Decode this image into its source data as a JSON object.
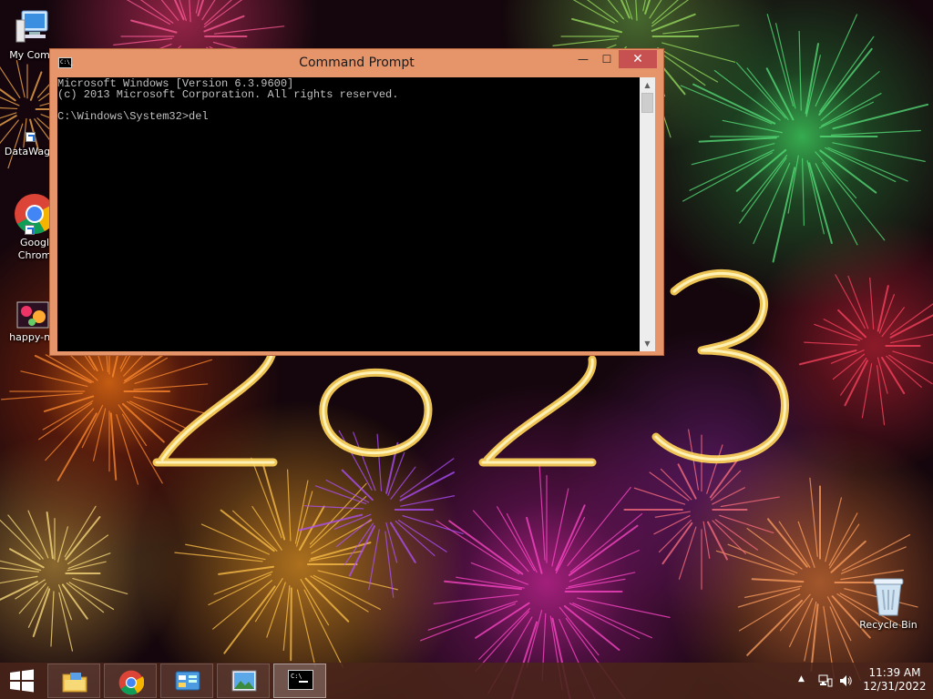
{
  "desktop": {
    "icons": [
      {
        "label": "My Comp",
        "icon": "computer-icon"
      },
      {
        "label": "DataWag",
        "icon": "shortcut-icon"
      },
      {
        "label": "Googl",
        "label2": "Chrom",
        "icon": "chrome-icon"
      },
      {
        "label": "happy-ne",
        "icon": "image-file-icon"
      },
      {
        "label": "Recycle Bin",
        "icon": "recycle-bin-icon"
      }
    ]
  },
  "window": {
    "title": "Command Prompt",
    "controls": {
      "minimize": "—",
      "maximize": "☐",
      "close": "✕"
    },
    "console_lines": [
      "Microsoft Windows [Version 6.3.9600]",
      "(c) 2013 Microsoft Corporation. All rights reserved.",
      "",
      "C:\\Windows\\System32>del"
    ]
  },
  "taskbar": {
    "apps": [
      "file-explorer-icon",
      "chrome-icon",
      "control-panel-icon",
      "photos-icon",
      "command-prompt-icon"
    ],
    "active_app": "Command Prompt",
    "tray": {
      "icons": [
        "show-hidden-icons-icon",
        "network-icon",
        "volume-icon"
      ]
    },
    "clock": {
      "time": "11:39 AM",
      "date": "12/31/2022"
    }
  },
  "colors": {
    "window_frame": "#e6946a",
    "close_button": "#c75050",
    "console_bg": "#000000",
    "console_text": "#c0c0c0",
    "taskbar": "#4a241a"
  }
}
